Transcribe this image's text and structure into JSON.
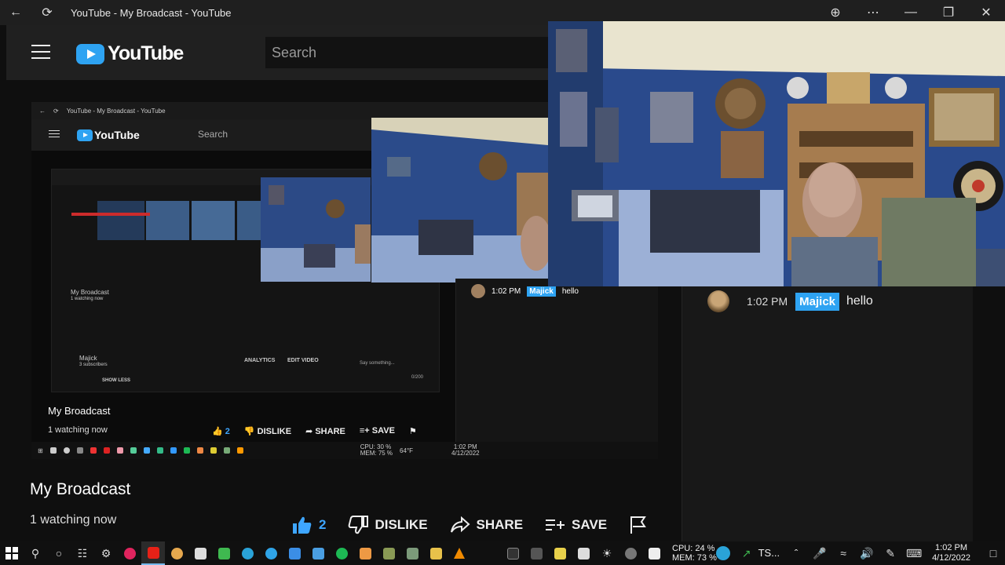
{
  "window": {
    "title": "YouTube - My Broadcast - YouTube"
  },
  "header": {
    "logo_text": "YouTube",
    "search_placeholder": "Search"
  },
  "inner_capture": {
    "window_title": "YouTube - My Broadcast - YouTube",
    "logo_text": "YouTube",
    "search_placeholder": "Search",
    "title": "My Broadcast",
    "watching": "1 watching now",
    "like_count": "2",
    "dislike": "DISLIKE",
    "share": "SHARE",
    "save": "SAVE",
    "nested_title": "My Broadcast",
    "nested_watching": "1 watching now",
    "nested_channel": "Majick",
    "nested_subs": "3 subscribers",
    "nested_analytics": "ANALYTICS",
    "nested_edit": "EDIT VIDEO",
    "nested_show_less": "SHOW LESS",
    "nested_say": "Say something...",
    "nested_count": "0/200",
    "chat_time": "1:02 PM",
    "chat_author": "Majick",
    "chat_text": "hello",
    "cpu": "CPU: 30 %",
    "mem": "MEM: 75 %",
    "weather": "64°F",
    "clock_time": "1:02 PM",
    "clock_date": "4/12/2022"
  },
  "video": {
    "title": "My Broadcast",
    "watching": "1 watching now",
    "like_count": "2",
    "dislike_label": "DISLIKE",
    "share_label": "SHARE",
    "save_label": "SAVE"
  },
  "chat": {
    "messages": [
      {
        "time": "1:02 PM",
        "author": "Majick",
        "text": "hello"
      }
    ]
  },
  "taskbar": {
    "cpu": "CPU: 24 %",
    "mem": "MEM: 73 %",
    "ts_label": "TS...",
    "clock_time": "1:02 PM",
    "clock_date": "4/12/2022"
  },
  "colors": {
    "accent": "#2ea3f2",
    "like_blue": "#3ea6ff"
  }
}
